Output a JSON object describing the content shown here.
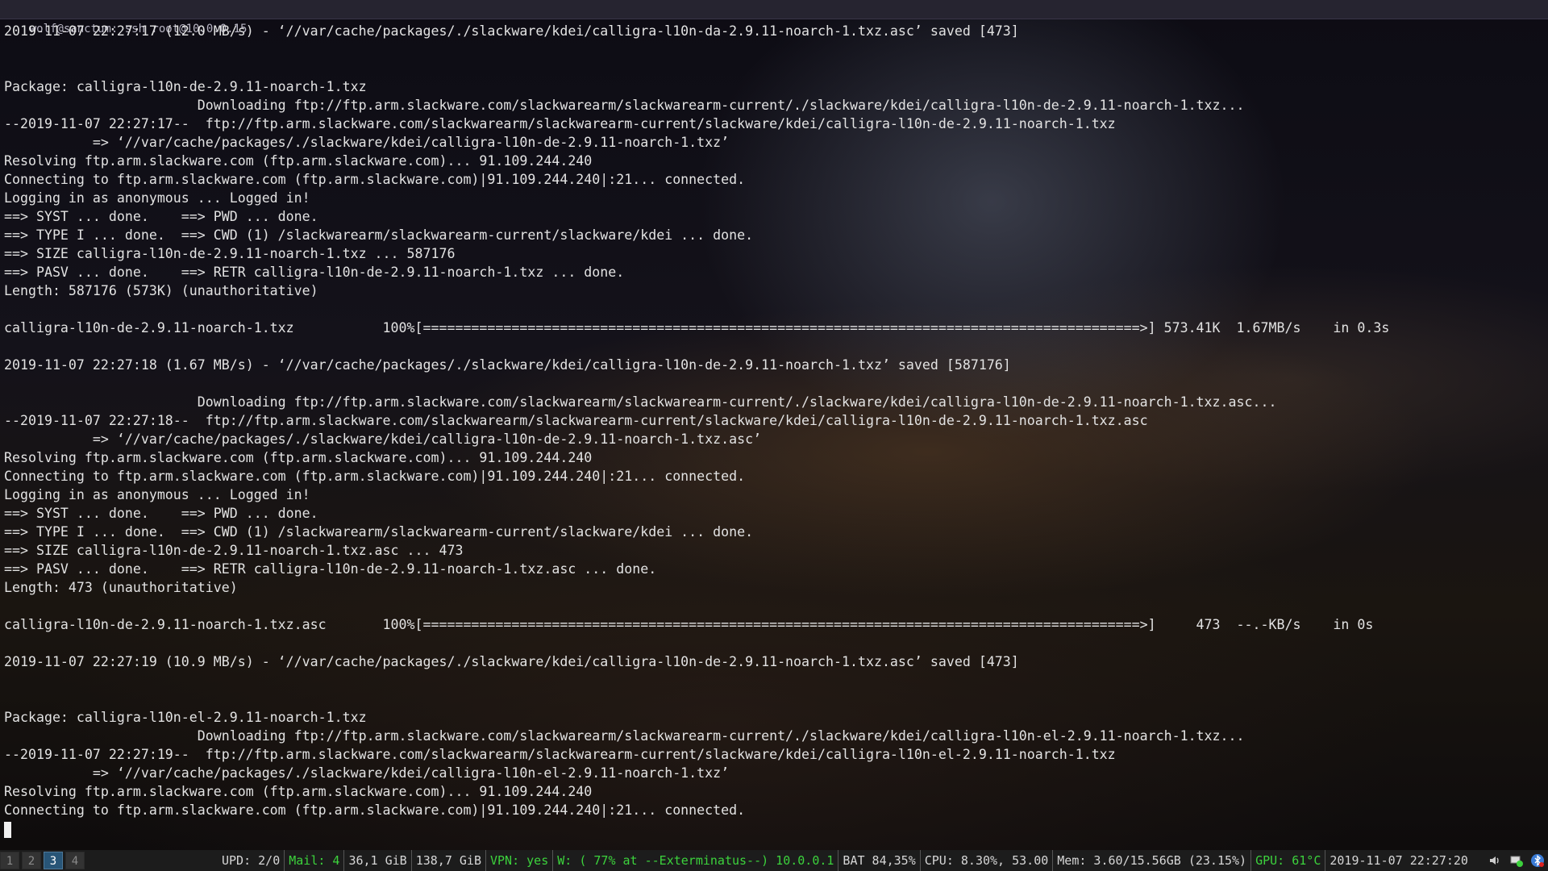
{
  "window": {
    "title": "wolf@sanctum: ssh root@10.0.0.15"
  },
  "terminal": {
    "lines": [
      "2019-11-07 22:27:17 (12.0 MB/s) - ‘//var/cache/packages/./slackware/kdei/calligra-l10n-da-2.9.11-noarch-1.txz.asc’ saved [473]",
      "",
      "",
      "Package: calligra-l10n-de-2.9.11-noarch-1.txz",
      "                        Downloading ftp://ftp.arm.slackware.com/slackwarearm/slackwarearm-current/./slackware/kdei/calligra-l10n-de-2.9.11-noarch-1.txz...",
      "--2019-11-07 22:27:17--  ftp://ftp.arm.slackware.com/slackwarearm/slackwarearm-current/slackware/kdei/calligra-l10n-de-2.9.11-noarch-1.txz",
      "           => ‘//var/cache/packages/./slackware/kdei/calligra-l10n-de-2.9.11-noarch-1.txz’",
      "Resolving ftp.arm.slackware.com (ftp.arm.slackware.com)... 91.109.244.240",
      "Connecting to ftp.arm.slackware.com (ftp.arm.slackware.com)|91.109.244.240|:21... connected.",
      "Logging in as anonymous ... Logged in!",
      "==> SYST ... done.    ==> PWD ... done.",
      "==> TYPE I ... done.  ==> CWD (1) /slackwarearm/slackwarearm-current/slackware/kdei ... done.",
      "==> SIZE calligra-l10n-de-2.9.11-noarch-1.txz ... 587176",
      "==> PASV ... done.    ==> RETR calligra-l10n-de-2.9.11-noarch-1.txz ... done.",
      "Length: 587176 (573K) (unauthoritative)",
      "",
      "calligra-l10n-de-2.9.11-noarch-1.txz           100%[=========================================================================================>] 573.41K  1.67MB/s    in 0.3s",
      "",
      "2019-11-07 22:27:18 (1.67 MB/s) - ‘//var/cache/packages/./slackware/kdei/calligra-l10n-de-2.9.11-noarch-1.txz’ saved [587176]",
      "",
      "                        Downloading ftp://ftp.arm.slackware.com/slackwarearm/slackwarearm-current/./slackware/kdei/calligra-l10n-de-2.9.11-noarch-1.txz.asc...",
      "--2019-11-07 22:27:18--  ftp://ftp.arm.slackware.com/slackwarearm/slackwarearm-current/slackware/kdei/calligra-l10n-de-2.9.11-noarch-1.txz.asc",
      "           => ‘//var/cache/packages/./slackware/kdei/calligra-l10n-de-2.9.11-noarch-1.txz.asc’",
      "Resolving ftp.arm.slackware.com (ftp.arm.slackware.com)... 91.109.244.240",
      "Connecting to ftp.arm.slackware.com (ftp.arm.slackware.com)|91.109.244.240|:21... connected.",
      "Logging in as anonymous ... Logged in!",
      "==> SYST ... done.    ==> PWD ... done.",
      "==> TYPE I ... done.  ==> CWD (1) /slackwarearm/slackwarearm-current/slackware/kdei ... done.",
      "==> SIZE calligra-l10n-de-2.9.11-noarch-1.txz.asc ... 473",
      "==> PASV ... done.    ==> RETR calligra-l10n-de-2.9.11-noarch-1.txz.asc ... done.",
      "Length: 473 (unauthoritative)",
      "",
      "calligra-l10n-de-2.9.11-noarch-1.txz.asc       100%[=========================================================================================>]     473  --.-KB/s    in 0s",
      "",
      "2019-11-07 22:27:19 (10.9 MB/s) - ‘//var/cache/packages/./slackware/kdei/calligra-l10n-de-2.9.11-noarch-1.txz.asc’ saved [473]",
      "",
      "",
      "Package: calligra-l10n-el-2.9.11-noarch-1.txz",
      "                        Downloading ftp://ftp.arm.slackware.com/slackwarearm/slackwarearm-current/./slackware/kdei/calligra-l10n-el-2.9.11-noarch-1.txz...",
      "--2019-11-07 22:27:19--  ftp://ftp.arm.slackware.com/slackwarearm/slackwarearm-current/slackware/kdei/calligra-l10n-el-2.9.11-noarch-1.txz",
      "           => ‘//var/cache/packages/./slackware/kdei/calligra-l10n-el-2.9.11-noarch-1.txz’",
      "Resolving ftp.arm.slackware.com (ftp.arm.slackware.com)... 91.109.244.240",
      "Connecting to ftp.arm.slackware.com (ftp.arm.slackware.com)|91.109.244.240|:21... connected."
    ]
  },
  "statusbar": {
    "workspaces": [
      {
        "label": "1",
        "active": false
      },
      {
        "label": "2",
        "active": false
      },
      {
        "label": "3",
        "active": true
      },
      {
        "label": "4",
        "active": false
      }
    ],
    "blocks": [
      {
        "name": "updates-block",
        "text": "UPD: 2/0",
        "color": "#d6d6d6"
      },
      {
        "name": "mail-block",
        "text": "Mail: 4",
        "color": "#3cd23c"
      },
      {
        "name": "disk-root-block",
        "text": "36,1 GiB",
        "color": "#d6d6d6"
      },
      {
        "name": "disk-home-block",
        "text": "138,7 GiB",
        "color": "#d6d6d6"
      },
      {
        "name": "vpn-block",
        "text": "VPN: yes",
        "color": "#3cd23c"
      },
      {
        "name": "wifi-block",
        "text": "W: ( 77% at --Exterminatus--) 10.0.0.1",
        "color": "#3cd23c"
      },
      {
        "name": "battery-block",
        "text": "BAT 84,35%",
        "color": "#d6d6d6"
      },
      {
        "name": "cpu-block",
        "text": "CPU: 8.30%, 53.00",
        "color": "#d6d6d6"
      },
      {
        "name": "memory-block",
        "text": "Mem: 3.60/15.56GB (23.15%)",
        "color": "#d6d6d6"
      },
      {
        "name": "gpu-block",
        "text": "GPU: 61°C",
        "color": "#3cd23c"
      },
      {
        "name": "clock-block",
        "text": "2019-11-07 22:27:20",
        "color": "#d6d6d6"
      }
    ],
    "tray": [
      {
        "icon": "volume-icon",
        "color": "#cccccc"
      },
      {
        "icon": "network-icon",
        "color": "#3cd23c"
      },
      {
        "icon": "bluetooth-icon",
        "color": "#3a7bd5"
      }
    ]
  }
}
